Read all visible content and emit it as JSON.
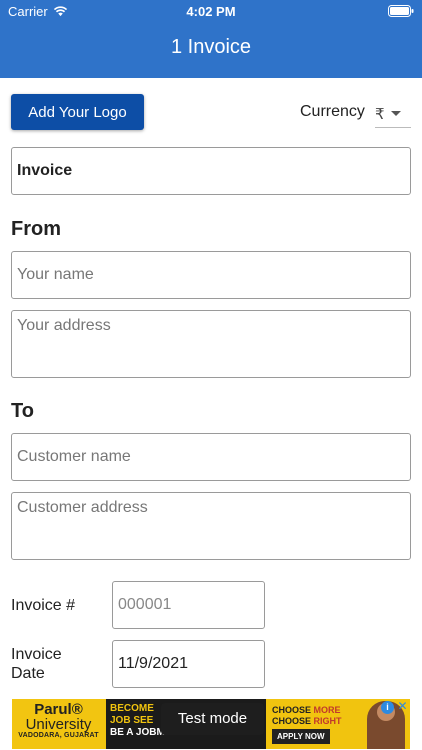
{
  "status_bar": {
    "carrier": "Carrier",
    "time": "4:02 PM"
  },
  "header": {
    "title": "1 Invoice"
  },
  "toolbar": {
    "logo_button_label": "Add Your Logo",
    "currency_label": "Currency",
    "currency_value": "₹"
  },
  "invoice_title": {
    "value": "Invoice"
  },
  "from": {
    "heading": "From",
    "name_placeholder": "Your name",
    "address_placeholder": "Your address"
  },
  "to": {
    "heading": "To",
    "name_placeholder": "Customer name",
    "address_placeholder": "Customer address"
  },
  "details": {
    "invoice_number_label": "Invoice #",
    "invoice_number_placeholder": "000001",
    "invoice_date_label": "Invoice Date",
    "invoice_date_value": "11/9/2021"
  },
  "ad": {
    "brand": "Parul®",
    "brand_line2": "University",
    "city": "VADODARA, GUJARAT",
    "line1": "BECOME",
    "line2": "JOB SEE",
    "line3": "BE A JOBMAKER",
    "right_line1_a": "CHOOSE ",
    "right_line1_b": "MORE",
    "right_line2_a": "CHOOSE ",
    "right_line2_b": "RIGHT",
    "apply": "APPLY NOW",
    "test_mode": "Test mode"
  },
  "colors": {
    "header_bg": "#2f73c9",
    "button_bg": "#0d4ea6"
  },
  "icons": [
    "wifi-icon",
    "battery-icon",
    "chevron-down-icon",
    "info-icon",
    "close-icon"
  ]
}
